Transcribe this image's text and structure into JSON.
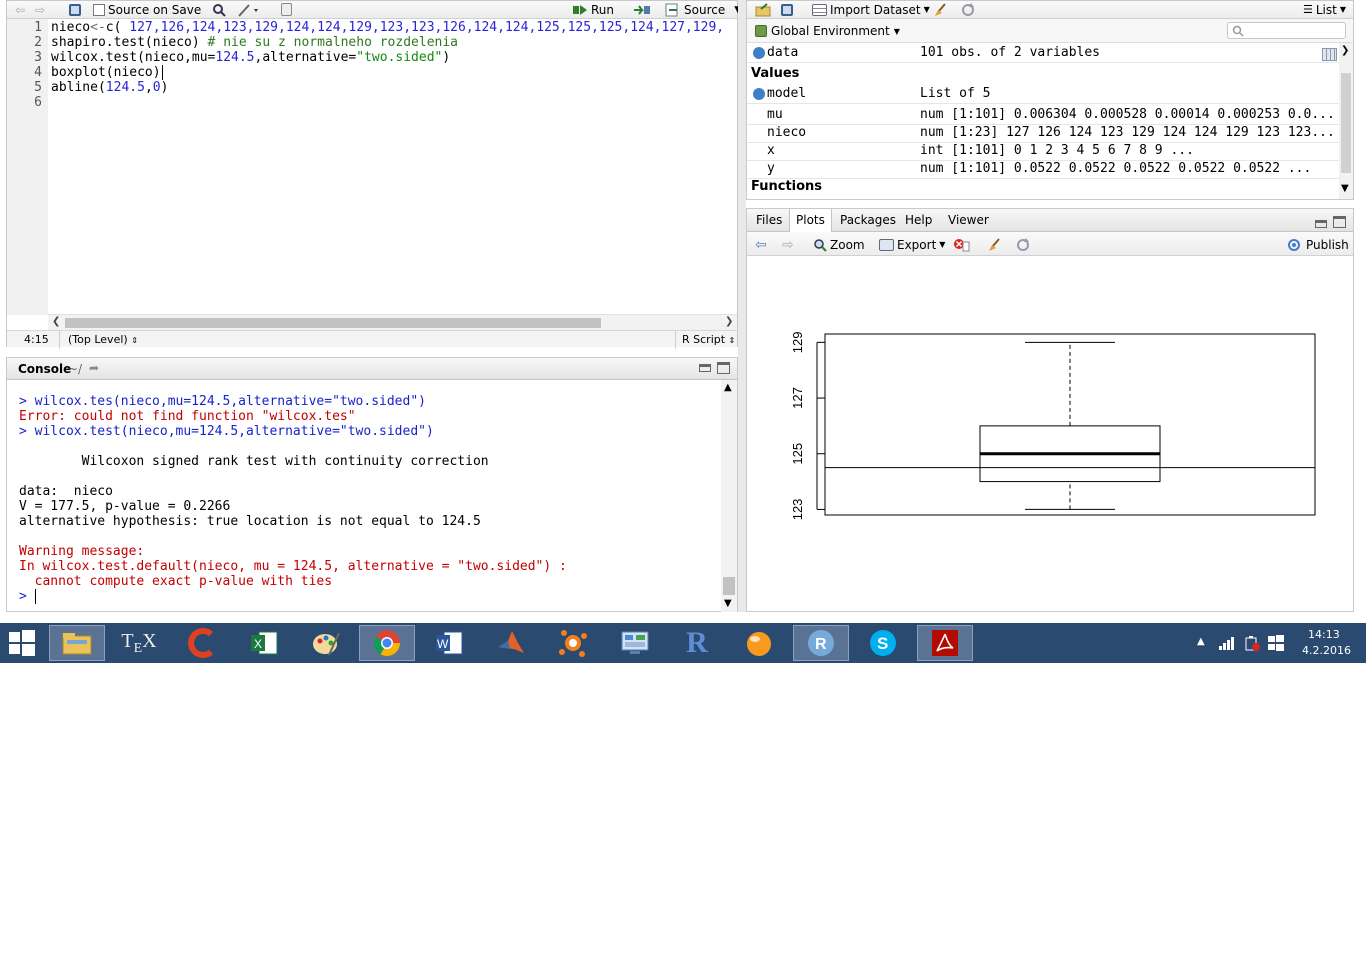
{
  "editor": {
    "toolbar": {
      "source_on_save": "Source on Save",
      "run": "Run",
      "source": "Source"
    },
    "lines": [
      {
        "num": "1"
      },
      {
        "num": "2"
      },
      {
        "num": "3"
      },
      {
        "num": "4"
      },
      {
        "num": "5"
      },
      {
        "num": "6"
      }
    ],
    "code": {
      "l1_fn": "nieco",
      "l1_op": "<-",
      "l1_c": "c( ",
      "l1_values": "127,126,124,123,129,124,124,129,123,123,126,124,124,125,125,125,124,127,129,",
      "l2_code": "shapiro.test(nieco) ",
      "l2_comment": "# nie su z normalneho rozdelenia",
      "l3_a": "wilcox.test(nieco,mu=",
      "l3_num": "124.5",
      "l3_b": ",alternative=",
      "l3_str": "\"two.sided\"",
      "l3_c": ")",
      "l4": "boxplot(nieco)",
      "l5_a": "abline(",
      "l5_num1": "124.5",
      "l5_comma": ",",
      "l5_num2": "0",
      "l5_b": ")"
    },
    "status": {
      "position": "4:15",
      "scope": "(Top Level)",
      "type": "R Script"
    }
  },
  "console": {
    "title": "Console",
    "path": "~/",
    "lines": {
      "c1": "> wilcox.tes(nieco,mu=124.5,alternative=\"two.sided\")",
      "c2": "Error: could not find function \"wilcox.tes\"",
      "c3": "> wilcox.test(nieco,mu=124.5,alternative=\"two.sided\")",
      "c4": "        Wilcoxon signed rank test with continuity correction",
      "c5": "data:  nieco",
      "c6": "V = 177.5, p-value = 0.2266",
      "c7": "alternative hypothesis: true location is not equal to 124.5",
      "c8": "Warning message:",
      "c9": "In wilcox.test.default(nieco, mu = 124.5, alternative = \"two.sided\") :",
      "c10": "  cannot compute exact p-value with ties",
      "c11": ">"
    }
  },
  "environment": {
    "toolbar": {
      "import": "Import Dataset",
      "list": "List",
      "global": "Global Environment"
    },
    "data_row": {
      "name": "data",
      "value": "101 obs. of 2 variables"
    },
    "values_header": "Values",
    "rows": [
      {
        "name": "model",
        "value": "List of 5"
      },
      {
        "name": "mu",
        "value": "num [1:101] 0.006304 0.000528 0.00014 0.000253 0.0..."
      },
      {
        "name": "nieco",
        "value": "num [1:23] 127 126 124 123 129 124 124 129 123 123..."
      },
      {
        "name": "x",
        "value": "int [1:101] 0 1 2 3 4 5 6 7 8 9 ..."
      },
      {
        "name": "y",
        "value": "num [1:101] 0.0522 0.0522 0.0522 0.0522 0.0522 ..."
      }
    ],
    "functions_header": "Functions"
  },
  "files_pane": {
    "tabs": [
      "Files",
      "Plots",
      "Packages",
      "Help",
      "Viewer"
    ],
    "toolbar": {
      "zoom": "Zoom",
      "export": "Export",
      "publish": "Publish"
    }
  },
  "plot": {
    "y_ticks": [
      "123",
      "125",
      "127",
      "129"
    ]
  },
  "chart_data": {
    "type": "boxplot",
    "ylim": [
      122.8,
      129.3
    ],
    "y_ticks": [
      123,
      125,
      127,
      129
    ],
    "box": {
      "min": 123,
      "q1": 124,
      "median": 125,
      "q3": 126,
      "max": 129
    },
    "abline_y": 124.5
  },
  "taskbar": {
    "time": "14:13",
    "date": "4.2.2016",
    "icons": [
      {
        "name": "windows-start-icon"
      },
      {
        "name": "file-explorer-icon"
      },
      {
        "name": "tex-icon"
      },
      {
        "name": "ccleaner-icon"
      },
      {
        "name": "excel-icon"
      },
      {
        "name": "paint-icon"
      },
      {
        "name": "chrome-icon"
      },
      {
        "name": "word-icon"
      },
      {
        "name": "matlab-icon"
      },
      {
        "name": "avast-icon"
      },
      {
        "name": "control-panel-icon"
      },
      {
        "name": "r-icon"
      },
      {
        "name": "r-ball-icon"
      },
      {
        "name": "rstudio-icon"
      },
      {
        "name": "skype-icon"
      },
      {
        "name": "acrobat-icon"
      }
    ]
  }
}
